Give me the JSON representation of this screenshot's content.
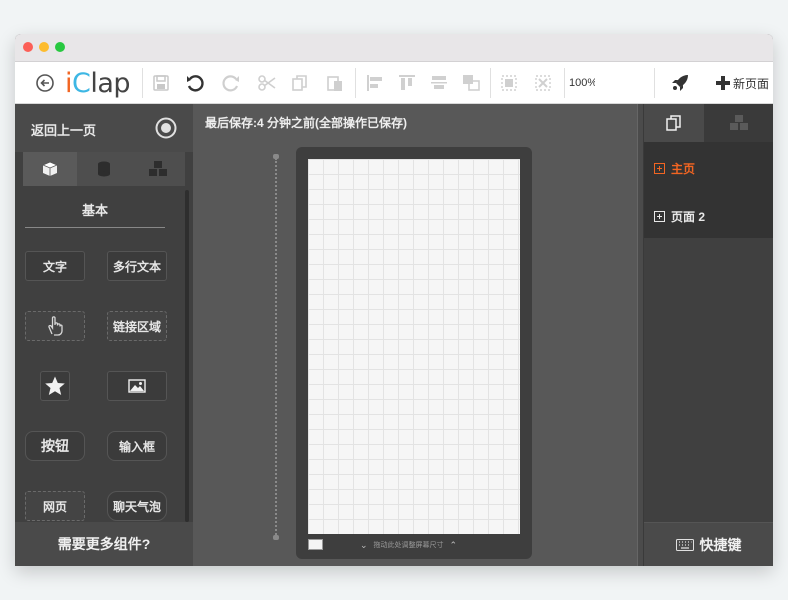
{
  "window": {
    "traffic_lights": [
      "#fc5f57",
      "#fdbc2e",
      "#28c840"
    ]
  },
  "toolbar": {
    "logo_i": "i",
    "logo_c": "C",
    "logo_rest": "lap",
    "zoom_value": "100%",
    "new_page_label": "新页面"
  },
  "left_panel": {
    "back_label": "返回上一页",
    "section_title": "基本",
    "components": {
      "text": "文字",
      "multiline_text": "多行文本",
      "link_area": "链接区域",
      "button": "按钮",
      "input_box": "输入框",
      "webpage": "网页",
      "chat_bubble": "聊天气泡"
    },
    "footer_label": "需要更多组件?"
  },
  "canvas": {
    "save_status": "最后保存:4 分钟之前(全部操作已保存)",
    "resize_hint": "拖动此处调整屏幕尺寸"
  },
  "right_panel": {
    "pages": [
      {
        "label": "主页",
        "active": true
      },
      {
        "label": "页面 2",
        "active": false
      }
    ],
    "shortcuts_label": "快捷键"
  },
  "colors": {
    "accent": "#f26522",
    "panel_dark": "#404040",
    "canvas_bg": "#585858"
  }
}
